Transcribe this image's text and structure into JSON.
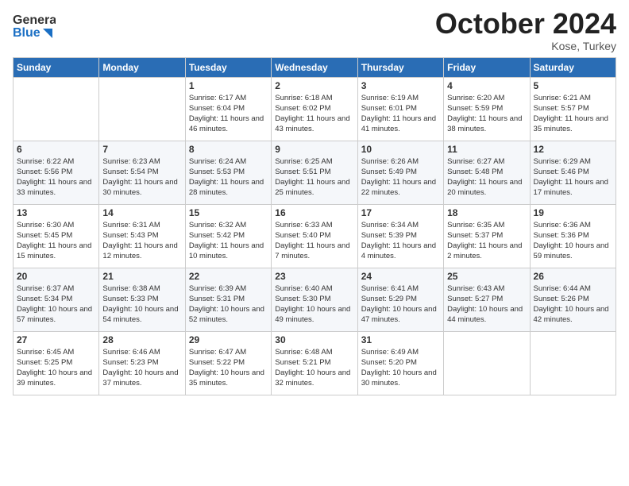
{
  "header": {
    "logo_line1": "General",
    "logo_line2": "Blue",
    "month": "October 2024",
    "location": "Kose, Turkey"
  },
  "days_of_week": [
    "Sunday",
    "Monday",
    "Tuesday",
    "Wednesday",
    "Thursday",
    "Friday",
    "Saturday"
  ],
  "weeks": [
    [
      {
        "day": "",
        "info": ""
      },
      {
        "day": "",
        "info": ""
      },
      {
        "day": "1",
        "info": "Sunrise: 6:17 AM\nSunset: 6:04 PM\nDaylight: 11 hours and 46 minutes."
      },
      {
        "day": "2",
        "info": "Sunrise: 6:18 AM\nSunset: 6:02 PM\nDaylight: 11 hours and 43 minutes."
      },
      {
        "day": "3",
        "info": "Sunrise: 6:19 AM\nSunset: 6:01 PM\nDaylight: 11 hours and 41 minutes."
      },
      {
        "day": "4",
        "info": "Sunrise: 6:20 AM\nSunset: 5:59 PM\nDaylight: 11 hours and 38 minutes."
      },
      {
        "day": "5",
        "info": "Sunrise: 6:21 AM\nSunset: 5:57 PM\nDaylight: 11 hours and 35 minutes."
      }
    ],
    [
      {
        "day": "6",
        "info": "Sunrise: 6:22 AM\nSunset: 5:56 PM\nDaylight: 11 hours and 33 minutes."
      },
      {
        "day": "7",
        "info": "Sunrise: 6:23 AM\nSunset: 5:54 PM\nDaylight: 11 hours and 30 minutes."
      },
      {
        "day": "8",
        "info": "Sunrise: 6:24 AM\nSunset: 5:53 PM\nDaylight: 11 hours and 28 minutes."
      },
      {
        "day": "9",
        "info": "Sunrise: 6:25 AM\nSunset: 5:51 PM\nDaylight: 11 hours and 25 minutes."
      },
      {
        "day": "10",
        "info": "Sunrise: 6:26 AM\nSunset: 5:49 PM\nDaylight: 11 hours and 22 minutes."
      },
      {
        "day": "11",
        "info": "Sunrise: 6:27 AM\nSunset: 5:48 PM\nDaylight: 11 hours and 20 minutes."
      },
      {
        "day": "12",
        "info": "Sunrise: 6:29 AM\nSunset: 5:46 PM\nDaylight: 11 hours and 17 minutes."
      }
    ],
    [
      {
        "day": "13",
        "info": "Sunrise: 6:30 AM\nSunset: 5:45 PM\nDaylight: 11 hours and 15 minutes."
      },
      {
        "day": "14",
        "info": "Sunrise: 6:31 AM\nSunset: 5:43 PM\nDaylight: 11 hours and 12 minutes."
      },
      {
        "day": "15",
        "info": "Sunrise: 6:32 AM\nSunset: 5:42 PM\nDaylight: 11 hours and 10 minutes."
      },
      {
        "day": "16",
        "info": "Sunrise: 6:33 AM\nSunset: 5:40 PM\nDaylight: 11 hours and 7 minutes."
      },
      {
        "day": "17",
        "info": "Sunrise: 6:34 AM\nSunset: 5:39 PM\nDaylight: 11 hours and 4 minutes."
      },
      {
        "day": "18",
        "info": "Sunrise: 6:35 AM\nSunset: 5:37 PM\nDaylight: 11 hours and 2 minutes."
      },
      {
        "day": "19",
        "info": "Sunrise: 6:36 AM\nSunset: 5:36 PM\nDaylight: 10 hours and 59 minutes."
      }
    ],
    [
      {
        "day": "20",
        "info": "Sunrise: 6:37 AM\nSunset: 5:34 PM\nDaylight: 10 hours and 57 minutes."
      },
      {
        "day": "21",
        "info": "Sunrise: 6:38 AM\nSunset: 5:33 PM\nDaylight: 10 hours and 54 minutes."
      },
      {
        "day": "22",
        "info": "Sunrise: 6:39 AM\nSunset: 5:31 PM\nDaylight: 10 hours and 52 minutes."
      },
      {
        "day": "23",
        "info": "Sunrise: 6:40 AM\nSunset: 5:30 PM\nDaylight: 10 hours and 49 minutes."
      },
      {
        "day": "24",
        "info": "Sunrise: 6:41 AM\nSunset: 5:29 PM\nDaylight: 10 hours and 47 minutes."
      },
      {
        "day": "25",
        "info": "Sunrise: 6:43 AM\nSunset: 5:27 PM\nDaylight: 10 hours and 44 minutes."
      },
      {
        "day": "26",
        "info": "Sunrise: 6:44 AM\nSunset: 5:26 PM\nDaylight: 10 hours and 42 minutes."
      }
    ],
    [
      {
        "day": "27",
        "info": "Sunrise: 6:45 AM\nSunset: 5:25 PM\nDaylight: 10 hours and 39 minutes."
      },
      {
        "day": "28",
        "info": "Sunrise: 6:46 AM\nSunset: 5:23 PM\nDaylight: 10 hours and 37 minutes."
      },
      {
        "day": "29",
        "info": "Sunrise: 6:47 AM\nSunset: 5:22 PM\nDaylight: 10 hours and 35 minutes."
      },
      {
        "day": "30",
        "info": "Sunrise: 6:48 AM\nSunset: 5:21 PM\nDaylight: 10 hours and 32 minutes."
      },
      {
        "day": "31",
        "info": "Sunrise: 6:49 AM\nSunset: 5:20 PM\nDaylight: 10 hours and 30 minutes."
      },
      {
        "day": "",
        "info": ""
      },
      {
        "day": "",
        "info": ""
      }
    ]
  ]
}
